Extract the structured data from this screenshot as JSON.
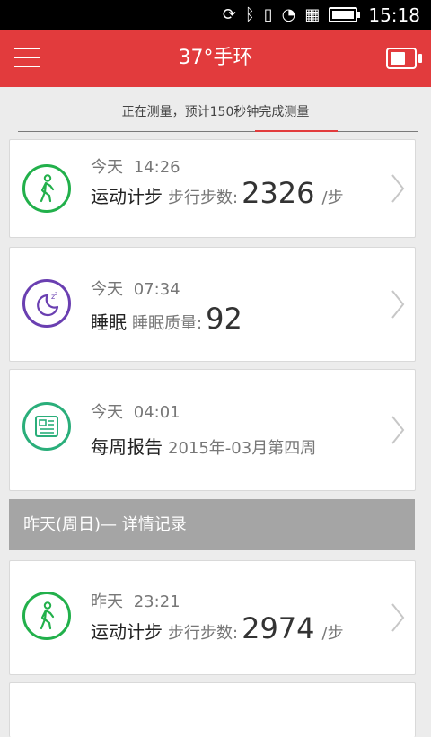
{
  "status_bar": {
    "time": "15:18"
  },
  "app_bar": {
    "title": "37°手环"
  },
  "measure": {
    "text": "正在测量，预计150秒钟完成测量"
  },
  "cards": [
    {
      "type": "steps",
      "date": "今天",
      "time": "14:26",
      "label": "运动计步",
      "metric": "步行步数:",
      "value": "2326",
      "unit": "/步"
    },
    {
      "type": "sleep",
      "date": "今天",
      "time": "07:34",
      "label": "睡眠",
      "metric": "睡眠质量:",
      "value": "92"
    },
    {
      "type": "report",
      "date": "今天",
      "time": "04:01",
      "label": "每周报告",
      "detail": "2015年-03月第四周"
    },
    {
      "type": "steps",
      "date": "昨天",
      "time": "23:21",
      "label": "运动计步",
      "metric": "步行步数:",
      "value": "2974",
      "unit": "/步"
    }
  ],
  "section_header": {
    "text": "昨天(周日)— 详情记录"
  },
  "colors": {
    "accent": "#e23b3d",
    "steps_icon": "#22b04b",
    "sleep_icon": "#6a3fb1",
    "report_icon": "#2aae7a"
  }
}
